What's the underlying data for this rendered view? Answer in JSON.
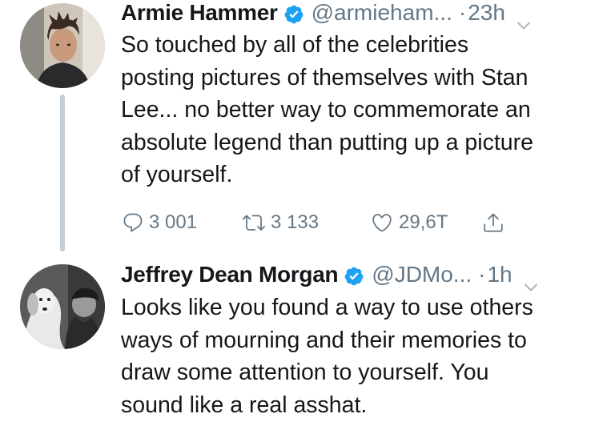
{
  "tweets": [
    {
      "author_name": "Armie Hammer",
      "handle": "@armieham...",
      "dot": "·",
      "time": "23h",
      "lines": [
        "So touched by all of the celebrities",
        "posting pictures of themselves with Stan",
        "Lee... no better way to commemorate an",
        "absolute legend than putting up a picture",
        "of yourself."
      ],
      "replies": "3 001",
      "retweets": "3 133",
      "likes": "29,6T"
    },
    {
      "author_name": "Jeffrey Dean Morgan",
      "handle": "@JDMo...",
      "dot": "·",
      "time": "1h",
      "lines": [
        "Looks like you found a way to use others",
        "ways of mourning and their memories to",
        "draw some attention to yourself. You",
        "sound like a real asshat."
      ]
    }
  ],
  "colors": {
    "verified": "#1da1f2",
    "muted": "#657786",
    "thread_line": "#c4cfd6"
  }
}
